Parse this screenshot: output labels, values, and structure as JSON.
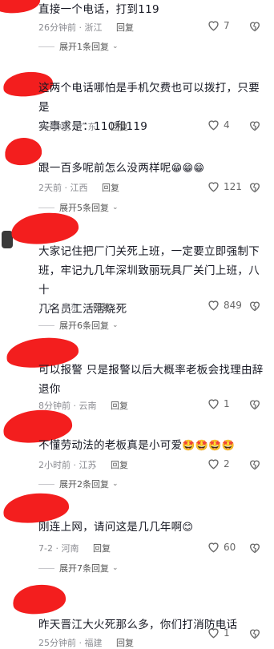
{
  "comments": [
    {
      "text": "直接一个电话，打到119",
      "time": "26分钟前 · 浙江",
      "reply_label": "回复",
      "likes": "7",
      "expand": "展开1条回复"
    },
    {
      "text_line1": "这两个电话哪怕是手机欠费也可以拨打，只要是",
      "text_line2": "实事求是：110和119",
      "time": "4分钟前 · 广东",
      "reply_label": "回复",
      "likes": "4"
    },
    {
      "text": "跟一百多呢前怎么没两样呢",
      "emojis": "😁😁😁",
      "time": "2天前 · 江西",
      "reply_label": "回复",
      "likes": "121",
      "expand": "展开5条回复"
    },
    {
      "text_line1": "大家记住把厂门关死上班，一定要立即强制下",
      "text_line2": "班，牢记九几年深圳致丽玩具厂关门上班，八十",
      "text_line3": "几名员工活活烧死",
      "time": "7-1 · 广东",
      "reply_label": "回复",
      "likes": "849",
      "expand": "展开6条回复"
    },
    {
      "text_line1": "可以报警  只是报警以后大概率老板会找理由辞",
      "text_line2": "退你",
      "time": "8分钟前 · 云南",
      "reply_label": "回复",
      "likes": "1"
    },
    {
      "text": "不懂劳动法的老板真是小可爱",
      "emojis": "🤩🤩🤩🤩",
      "time": "2小时前 · 江苏",
      "reply_label": "回复",
      "likes": "2",
      "expand": "展开2条回复"
    },
    {
      "text": "刚连上网，请问这是几几年啊",
      "emojis": "😊",
      "time": "7-2 · 河南",
      "reply_label": "回复",
      "likes": "60",
      "expand": "展开7条回复"
    },
    {
      "text": "昨天晋江大火死那么多，你们打消防电话",
      "time": "25分钟前 · 福建",
      "reply_label": "回复",
      "likes": "1"
    }
  ],
  "colors": {
    "redaction": "#f31e1e",
    "meta": "#8a8b91"
  },
  "icons": {
    "like": "heart-outline-icon",
    "dislike": "broken-heart-icon",
    "expand": "chevron-down-icon"
  }
}
